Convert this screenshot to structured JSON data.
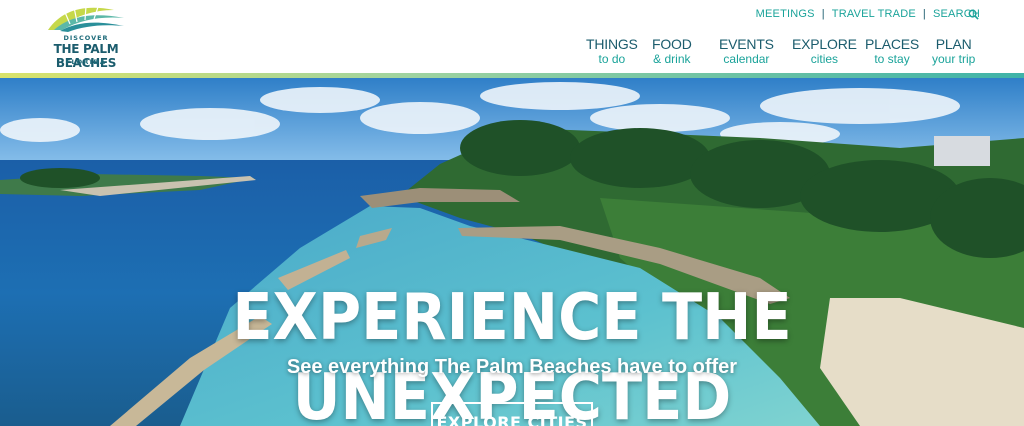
{
  "logo": {
    "line1": "DISCOVER",
    "line2": "THE PALM BEACHES",
    "line3": "FLORIDA"
  },
  "utility_nav": {
    "meetings": "MEETINGS",
    "travel_trade": "TRAVEL TRADE",
    "search": "SEARCH",
    "separator": "|",
    "search_icon": "search-icon"
  },
  "main_nav": [
    {
      "top": "THINGS",
      "bottom": "to do"
    },
    {
      "top": "FOOD",
      "bottom": "& drink"
    },
    {
      "top": "EVENTS",
      "bottom": "calendar"
    },
    {
      "top": "EXPLORE",
      "bottom": "cities"
    },
    {
      "top": "PLACES",
      "bottom": "to stay"
    },
    {
      "top": "PLAN",
      "bottom": "your trip"
    }
  ],
  "hero": {
    "headline": "EXPERIENCE THE UNEXPECTED",
    "subhead": "See everything The Palm Beaches have to offer",
    "cta": "EXPLORE CITIES"
  },
  "colors": {
    "brand_dark": "#1b5c6d",
    "brand_teal": "#1aa39a",
    "accent_lime": "#d9e26a"
  }
}
